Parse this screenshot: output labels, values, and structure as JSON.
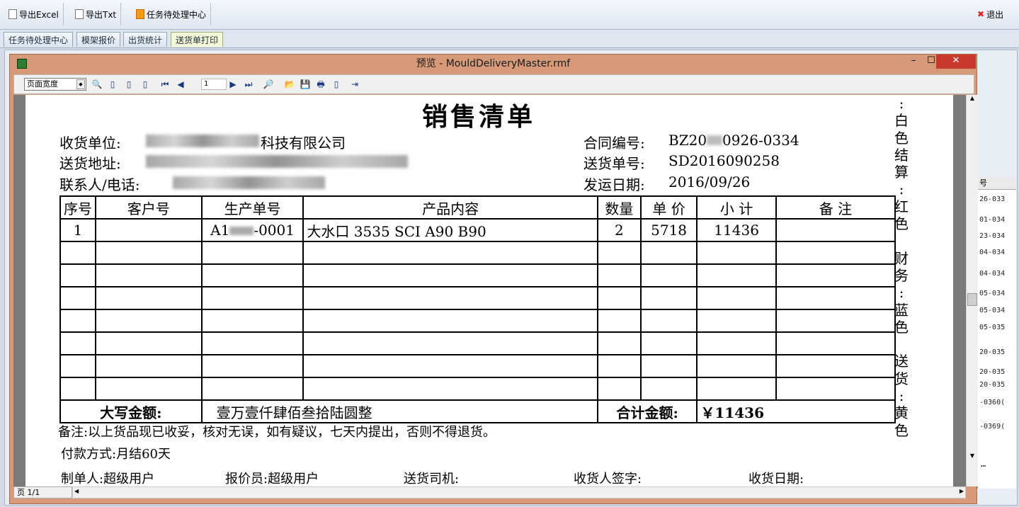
{
  "toolbar": {
    "export_excel": "导出Excel",
    "export_txt": "导出Txt",
    "task_center": "任务待处理中心",
    "exit": "退出"
  },
  "tabs": [
    "任务待处理中心",
    "模架报价",
    "出货统计",
    "送货单打印"
  ],
  "right_list": {
    "header": "号",
    "rows": [
      "26-033",
      "01-034",
      "23-034",
      "04-034",
      "04-034",
      "05-034",
      "05-034",
      "05-035",
      "20-035",
      "20-035",
      "20-035",
      "-0360(",
      "-0369("
    ],
    "more": "…"
  },
  "window": {
    "title": "预览 - MouldDeliveryMaster.rmf",
    "min": "–",
    "max": "☐",
    "close": "✕"
  },
  "preview_toolbar": {
    "zoom": "页面宽度",
    "page": "1"
  },
  "status": {
    "page": "页 1/1"
  },
  "document": {
    "title": "销售清单",
    "recv_unit_label": "收货单位:",
    "recv_unit_value": "科技有限公司",
    "addr_label": "送货地址:",
    "contact_label": "联系人/电话:",
    "contract_label": "合同编号:",
    "contract_value_a": "BZ20",
    "contract_value_b": "0926-0334",
    "delivery_no_label": "送货单号:",
    "delivery_no_value": "SD2016090258",
    "ship_date_label": "发运日期:",
    "ship_date_value": "2016/09/26",
    "headers": [
      "序号",
      "客户号",
      "生产单号",
      "产品内容",
      "数量",
      "单 价",
      "小 计",
      "备 注"
    ],
    "rows": [
      [
        "1",
        "",
        "A1",
        "-0001",
        "大水口 3535 SCI A90 B90",
        "2",
        "5718",
        "11436",
        ""
      ]
    ],
    "uppercase_label": "大写金额:",
    "uppercase_value": "壹万壹仟肆佰叁拾陆圆整",
    "total_label": "合计金额:",
    "total_value": "￥11436",
    "remark": "备注:以上货品现已收妥，核对无误，如有疑议，七天内提出，否则不得退货。",
    "payment": "付款方式:月结60天",
    "maker": "制单人:超级用户",
    "quoter": "报价员:超级用户",
    "driver": "送货司机:",
    "receiver_sign": "收货人签字:",
    "receive_date": "收货日期:",
    "side_text": [
      ":",
      "白",
      "色",
      "",
      "结",
      "算",
      ":",
      "红",
      "色",
      "",
      "财",
      "务",
      ":",
      "蓝",
      "色",
      "",
      "送",
      "货",
      ":",
      "黄",
      "色"
    ]
  }
}
